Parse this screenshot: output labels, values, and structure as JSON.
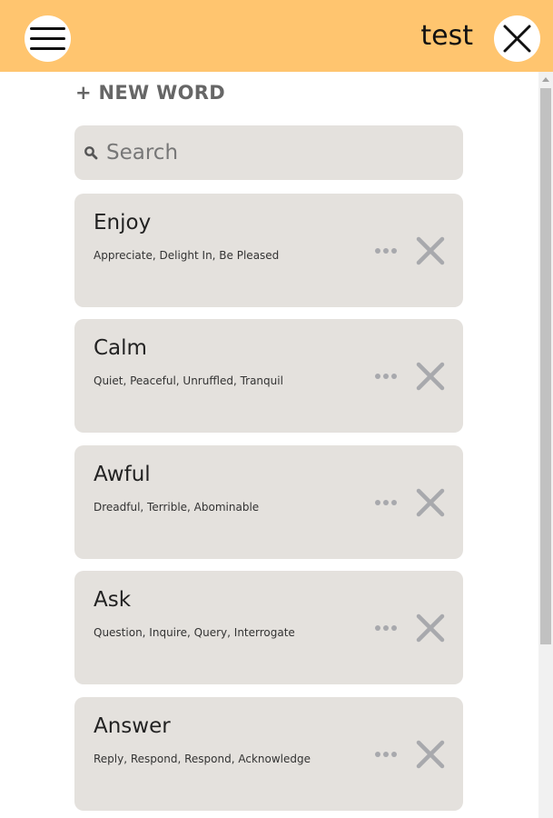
{
  "header": {
    "title": "test",
    "menu_icon": "hamburger-menu-icon",
    "close_icon": "close-icon",
    "background_color": "#ffc56f"
  },
  "actions": {
    "new_word_label": "+ NEW WORD"
  },
  "search": {
    "placeholder": "Search",
    "value": "",
    "icon": "search-icon"
  },
  "words": [
    {
      "word": "Enjoy",
      "synonyms": "Appreciate, Delight In, Be Pleased"
    },
    {
      "word": "Calm",
      "synonyms": "Quiet, Peaceful, Unruffled, Tranquil"
    },
    {
      "word": "Awful",
      "synonyms": "Dreadful, Terrible, Abominable"
    },
    {
      "word": "Ask",
      "synonyms": "Question, Inquire, Query, Interrogate"
    },
    {
      "word": "Answer",
      "synonyms": "Reply, Respond, Respond, Acknowledge"
    }
  ],
  "colors": {
    "card_background": "#e4e1dd",
    "icon_gray": "#a8a9ad"
  }
}
